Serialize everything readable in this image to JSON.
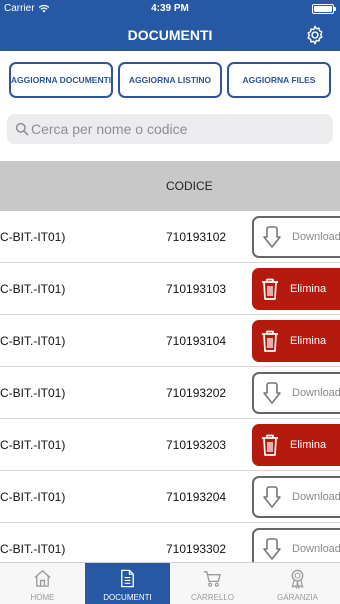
{
  "status_bar": {
    "carrier": "Carrier",
    "time": "4:39 PM"
  },
  "header": {
    "title": "DOCUMENTI",
    "settings_icon": "gear-icon"
  },
  "actions": [
    {
      "label": "AGGIORNA DOCUMENTI"
    },
    {
      "label": "AGGIORNA LISTINO"
    },
    {
      "label": "AGGIORNA FILES"
    }
  ],
  "search": {
    "placeholder": "Cerca per nome o codice"
  },
  "table": {
    "column_codice": "CODICE",
    "rows": [
      {
        "name": "C-BIT.-IT01)",
        "code": "710193102",
        "action": "download",
        "action_label": "Download"
      },
      {
        "name": "C-BIT.-IT01)",
        "code": "710193103",
        "action": "delete",
        "action_label": "Elimina"
      },
      {
        "name": "C-BIT.-IT01)",
        "code": "710193104",
        "action": "delete",
        "action_label": "Elimina"
      },
      {
        "name": "C-BIT.-IT01)",
        "code": "710193202",
        "action": "download",
        "action_label": "Download"
      },
      {
        "name": "C-BIT.-IT01)",
        "code": "710193203",
        "action": "delete",
        "action_label": "Elimina"
      },
      {
        "name": "C-BIT.-IT01)",
        "code": "710193204",
        "action": "download",
        "action_label": "Download"
      },
      {
        "name": "C-BIT.-IT01)",
        "code": "710193302",
        "action": "download",
        "action_label": "Download"
      }
    ]
  },
  "tabs": [
    {
      "label": "HOME",
      "icon": "home-icon",
      "active": false
    },
    {
      "label": "DOCUMENTI",
      "icon": "document-icon",
      "active": true
    },
    {
      "label": "CARRELLO",
      "icon": "cart-icon",
      "active": false
    },
    {
      "label": "GARANZIA",
      "icon": "award-icon",
      "active": false
    }
  ],
  "colors": {
    "primary": "#2658a3",
    "delete": "#b51a0f",
    "button_border": "#2f5597"
  }
}
